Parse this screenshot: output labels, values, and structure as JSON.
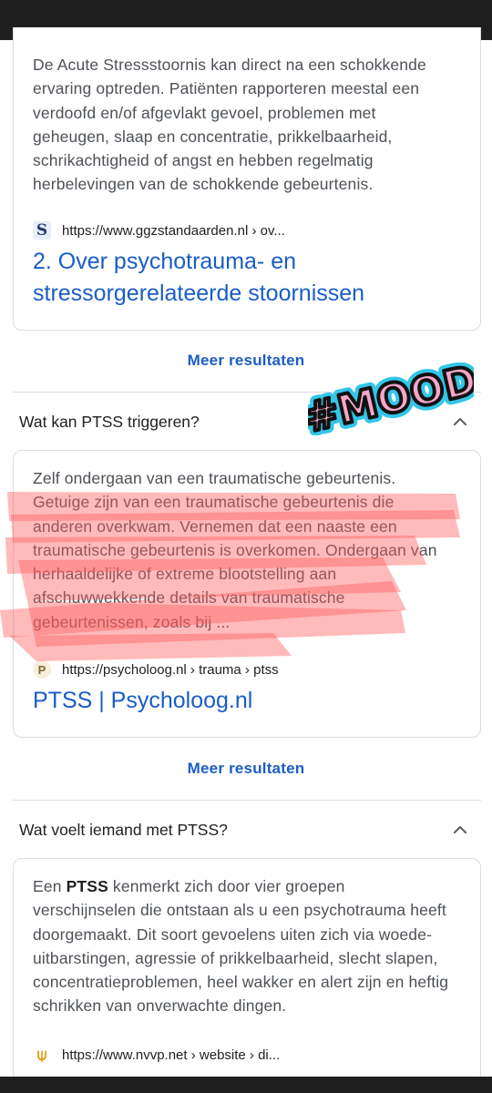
{
  "results": [
    {
      "snippet": "De Acute Stressstoornis kan direct na een schokkende ervaring optreden. Patiënten rapporteren meestal een verdoofd en/of afgevlakt gevoel, problemen met geheugen, slaap en concentratie, prikkelbaarheid, schrikachtigheid of angst en hebben regelmatig herbelevingen van de schokkende gebeurtenis.",
      "favicon_letter": "S",
      "url": "https://www.ggzstandaarden.nl › ov...",
      "title": "2. Over psychotrauma- en stressorgerelateerde stoornissen"
    },
    {
      "question": "Wat kan PTSS triggeren?",
      "snippet": "Zelf ondergaan van een traumatische gebeurtenis. Getuige zijn van een traumatische gebeurtenis die anderen overkwam. Vernemen dat een naaste een traumatische gebeurtenis is overkomen. Ondergaan van herhaaldelijke of extreme blootstelling aan afschuwwekkende details van traumatische gebeurtenissen, zoals bij ...",
      "favicon_letter": "P",
      "url": "https://psycholoog.nl › trauma › ptss",
      "title": "PTSS | Psycholoog.nl"
    },
    {
      "question": "Wat voelt iemand met PTSS?",
      "snippet_bold": "PTSS",
      "snippet_pre": "Een ",
      "snippet_post": " kenmerkt zich door vier groepen verschijnselen die ontstaan als u een psychotrauma heeft doorgemaakt. Dit soort gevoelens uiten zich via woede-uitbarstingen, agressie of prikkelbaarheid, slecht slapen, concentratieproblemen, heel wakker en alert zijn en heftig schrikken van onverwachte dingen.",
      "favicon_letter": "⍦",
      "url": "https://www.nvvp.net › website › di..."
    }
  ],
  "more_results_label": "Meer resultaten",
  "sticker_text": "#MOOD",
  "colors": {
    "link": "#1a5dc6",
    "highlight": "#ff5a5a",
    "sticker_fill": "#f7a6c8",
    "sticker_outline": "#33c6e8"
  }
}
